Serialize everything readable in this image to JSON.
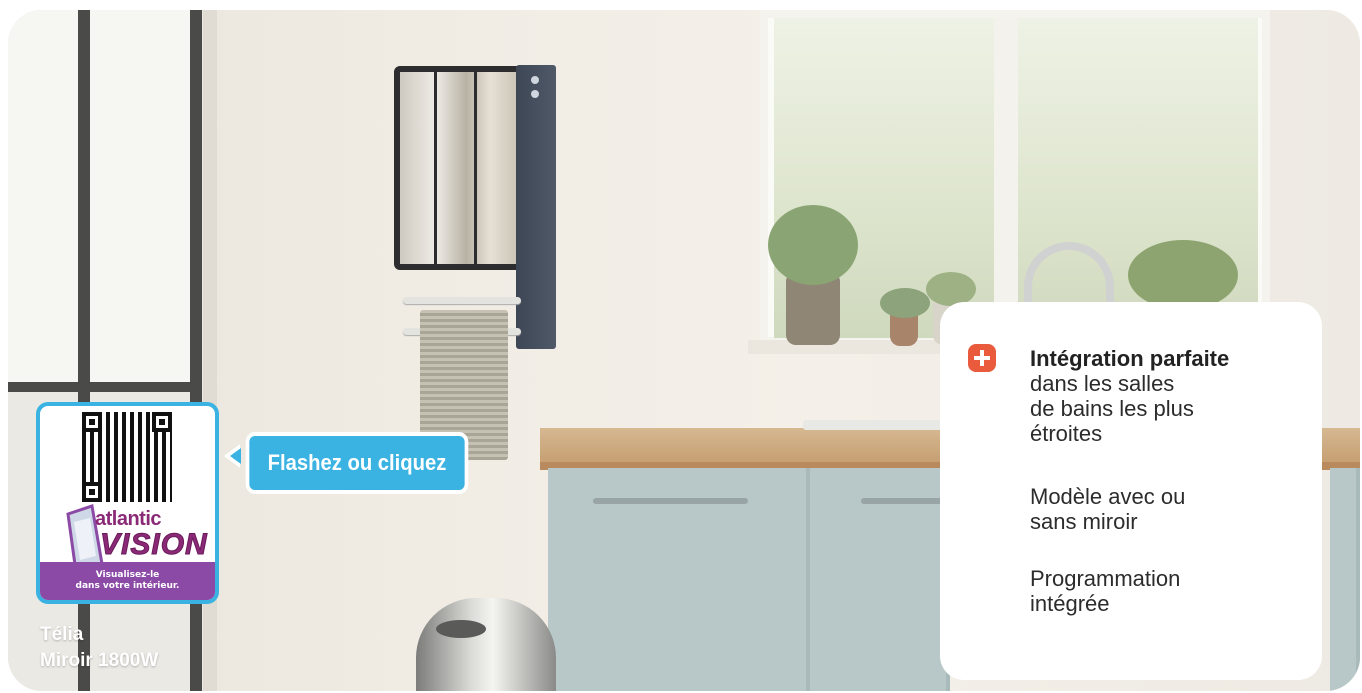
{
  "qr_card": {
    "brand_small": "atlantic",
    "brand_big": "VISION",
    "tagline_line1": "Visualisez-le",
    "tagline_line2": "dans votre intérieur."
  },
  "cta": {
    "label": "Flashez ou cliquez"
  },
  "product": {
    "line1": "Télia",
    "line2": "Miroir 1800W"
  },
  "features": {
    "icon": "plus-icon",
    "title": "Intégration parfaite",
    "desc_line1": "dans les salles",
    "desc_line2": "de bains les plus",
    "desc_line3": "étroites",
    "feature2_line1": "Modèle avec ou",
    "feature2_line2": "sans miroir",
    "feature3_line1": "Programmation",
    "feature3_line2": "intégrée"
  },
  "colors": {
    "accent_blue": "#3ab3e2",
    "accent_orange": "#ea5a3c",
    "brand_purple": "#8b4aa6"
  }
}
